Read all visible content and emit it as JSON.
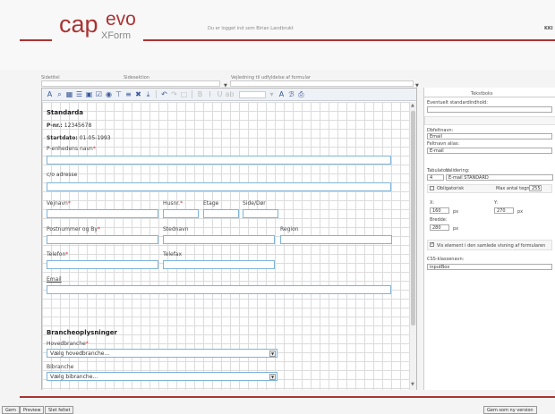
{
  "header": {
    "logo_cap": "cap",
    "logo_evo": "evo",
    "logo_xform": "XForm",
    "logged_in_text": "Du er logget ind som Birian Landbrukt",
    "logged_in_right": "KKI"
  },
  "form_meta": {
    "title_label": "Sidetitel",
    "section_label": "Sidesektion",
    "guidance_label": "Vejledning til udfyldelse af formular"
  },
  "toolbar": {
    "icons": [
      "font-size-icon",
      "find-icon",
      "table-icon",
      "list-icon",
      "image-icon",
      "checkbox-icon",
      "radio-icon",
      "field-icon",
      "align-icon",
      "delete-icon",
      "undo-icon",
      "redo-icon",
      "hr-icon",
      "bold-icon",
      "italic-icon",
      "underline-icon",
      "abc-icon",
      "font-color-icon",
      "bg-color-icon",
      "print-icon"
    ]
  },
  "form": {
    "standard_heading": "Standarda",
    "p_nr_label": "P-nr.:",
    "p_nr_value": "12345678",
    "startdate_label": "Startdato:",
    "startdate_value": "01-05-1993",
    "fields": {
      "p_name": "P-enhedens navn",
      "co_address": "c/o adresse",
      "vejnavn": "Vejnavn",
      "husnr": "Husnr.",
      "etage": "Etage",
      "side_dor": "Side/Dør",
      "postnr_by": "Postnummer og By",
      "stednavn": "Stednavn",
      "region": "Region",
      "telefon": "Telefon",
      "telefax": "Telefax",
      "email": "Email"
    },
    "req_mark": "*",
    "branch_heading": "Brancheoplysninger",
    "hovedbranche_label": "Hovedbranche",
    "hovedbranche_value": "Vælg hovedbranche...",
    "bibranche_label": "Bibranche",
    "bibranche_value": "Vælg bibranche..."
  },
  "properties": {
    "title": "Tekstboks",
    "default_value_label": "Eventuelt standardindhold:",
    "field_name_label": "Dbfeltnavn:",
    "field_name_value": "Email",
    "field_alias_label": "Feltnavn alias:",
    "field_alias_value": "E-mail",
    "tabulator_label": "Tabulator:",
    "tabulator_value": "4",
    "validation_label": "Validering:",
    "validation_value": "E-mail STANDARD",
    "required_label": "Obligatorisk",
    "max_chars_label": "Max antal tegn:",
    "max_chars_value": "255",
    "x_label": "X:",
    "x_value": "160",
    "px1": "px",
    "y_label": "Y:",
    "y_value": "270",
    "px2": "px",
    "width_label": "Bredde:",
    "width_value": "280",
    "px3": "px",
    "show_label": "Vis element i den samlede visning af formularen",
    "css_label": "CSS-klassenavn:",
    "css_value": "inputBox"
  },
  "bottom": {
    "btn1": "Gem",
    "btn2": "Preview",
    "btn3": "Slet feltet",
    "btn_right": "Gem som ny version"
  }
}
